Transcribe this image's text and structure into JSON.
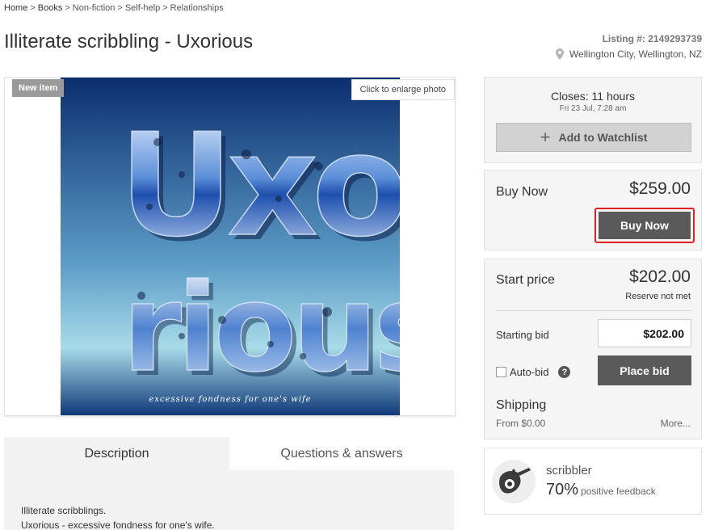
{
  "breadcrumb": [
    {
      "label": "Home"
    },
    {
      "label": "Books"
    },
    {
      "label": "Non-fiction"
    },
    {
      "label": "Self-help"
    },
    {
      "label": "Relationships"
    }
  ],
  "breadcrumb_separator": ">",
  "title": "Illiterate scribbling - Uxorious",
  "listing_number": "Listing #: 2149293739",
  "location": "Wellington City, Wellington, NZ",
  "photo": {
    "badge": "New item",
    "enlarge_label": "Click to enlarge photo",
    "cover_caption": "excessive fondness for one's wife"
  },
  "tabs": [
    {
      "label": "Description"
    },
    {
      "label": "Questions & answers"
    }
  ],
  "description": [
    "Illiterate scribblings.",
    "Uxorious - excessive fondness for one's wife."
  ],
  "closes": {
    "label": "Closes: 11 hours",
    "date": "Fri 23 Jul, 7:28 am",
    "watchlist_label": "Add to Watchlist"
  },
  "buy_now": {
    "label": "Buy Now",
    "price": "$259.00",
    "button_label": "Buy Now"
  },
  "bidding": {
    "start_label": "Start price",
    "start_price": "$202.00",
    "reserve_status": "Reserve not met",
    "starting_bid_label": "Starting bid",
    "bid_value": "$202.00",
    "autobid_label": "Auto-bid",
    "help_glyph": "?",
    "place_bid_label": "Place bid",
    "shipping_label": "Shipping",
    "shipping_from": "From $0.00",
    "more_label": "More..."
  },
  "seller": {
    "name": "scribbler",
    "feedback_pct": "70%",
    "feedback_label": "positive feedback"
  },
  "colors": {
    "highlight": "#e02020",
    "button": "#5a5a5a",
    "panel": "#f5f5f5"
  }
}
